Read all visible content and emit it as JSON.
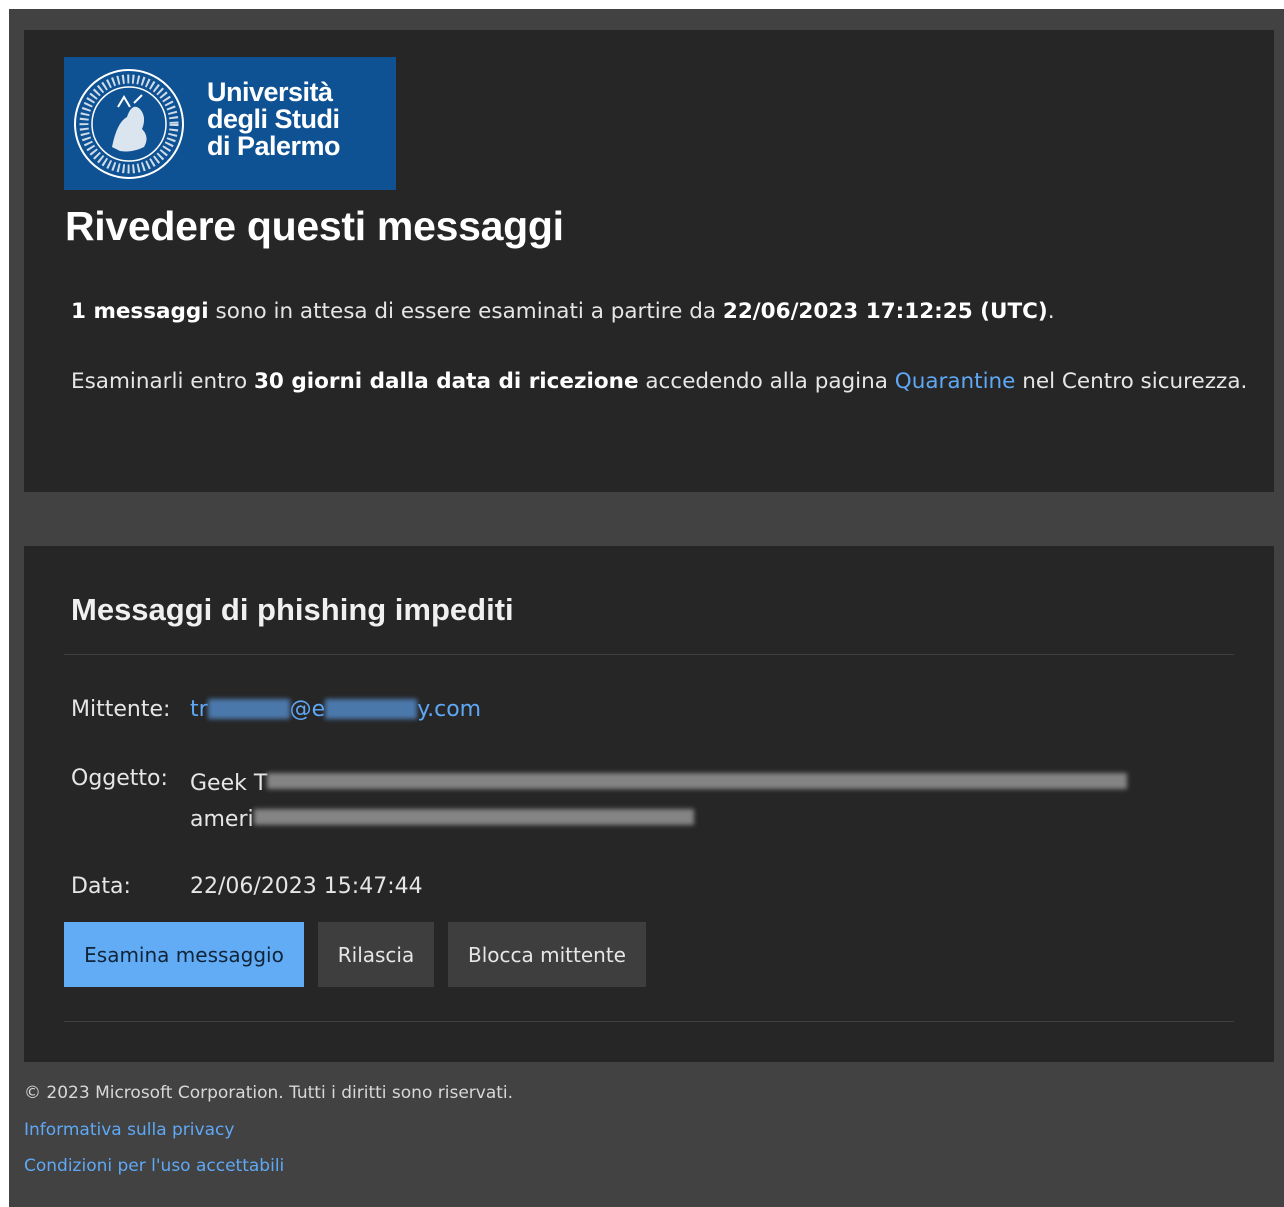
{
  "brand": {
    "name_lines": [
      "Università",
      "degli Studi",
      "di Palermo"
    ],
    "logo_color": "#0e5294",
    "seal_icon": "university-seal-icon"
  },
  "review": {
    "heading": "Rivedere questi messaggi",
    "line1": {
      "count": "1 messaggi",
      "text": " sono in attesa di essere esaminati a partire da ",
      "timestamp": "22/06/2023 17:12:25 (UTC)",
      "end": "."
    },
    "line2": {
      "pre": "Esaminarli entro ",
      "bold": "30 giorni dalla data di ricezione",
      "mid": " accedendo alla pagina ",
      "link": "Quarantine",
      "post": " nel Centro sicurezza."
    }
  },
  "phishing": {
    "title": "Messaggi di phishing impediti",
    "sender_label": "Mittente:",
    "sender_prefix": "tr",
    "sender_mid": "@e",
    "sender_suffix": "y.com",
    "subject_label": "Oggetto:",
    "subject_prefix": "Geek T",
    "subject_line2_prefix": "ameri",
    "date_label": "Data:",
    "date_value": "22/06/2023 15:47:44",
    "actions": {
      "review": "Esamina messaggio",
      "release": "Rilascia",
      "block": "Blocca mittente"
    }
  },
  "footer": {
    "copyright": "© 2023 Microsoft Corporation. Tutti i diritti sono riservati.",
    "privacy": "Informativa sulla privacy",
    "terms": "Condizioni per l'uso accettabili"
  },
  "colors": {
    "page": "#424242",
    "panel": "#262626",
    "link": "#5fa8f5",
    "primary_button": "#62acf6"
  }
}
